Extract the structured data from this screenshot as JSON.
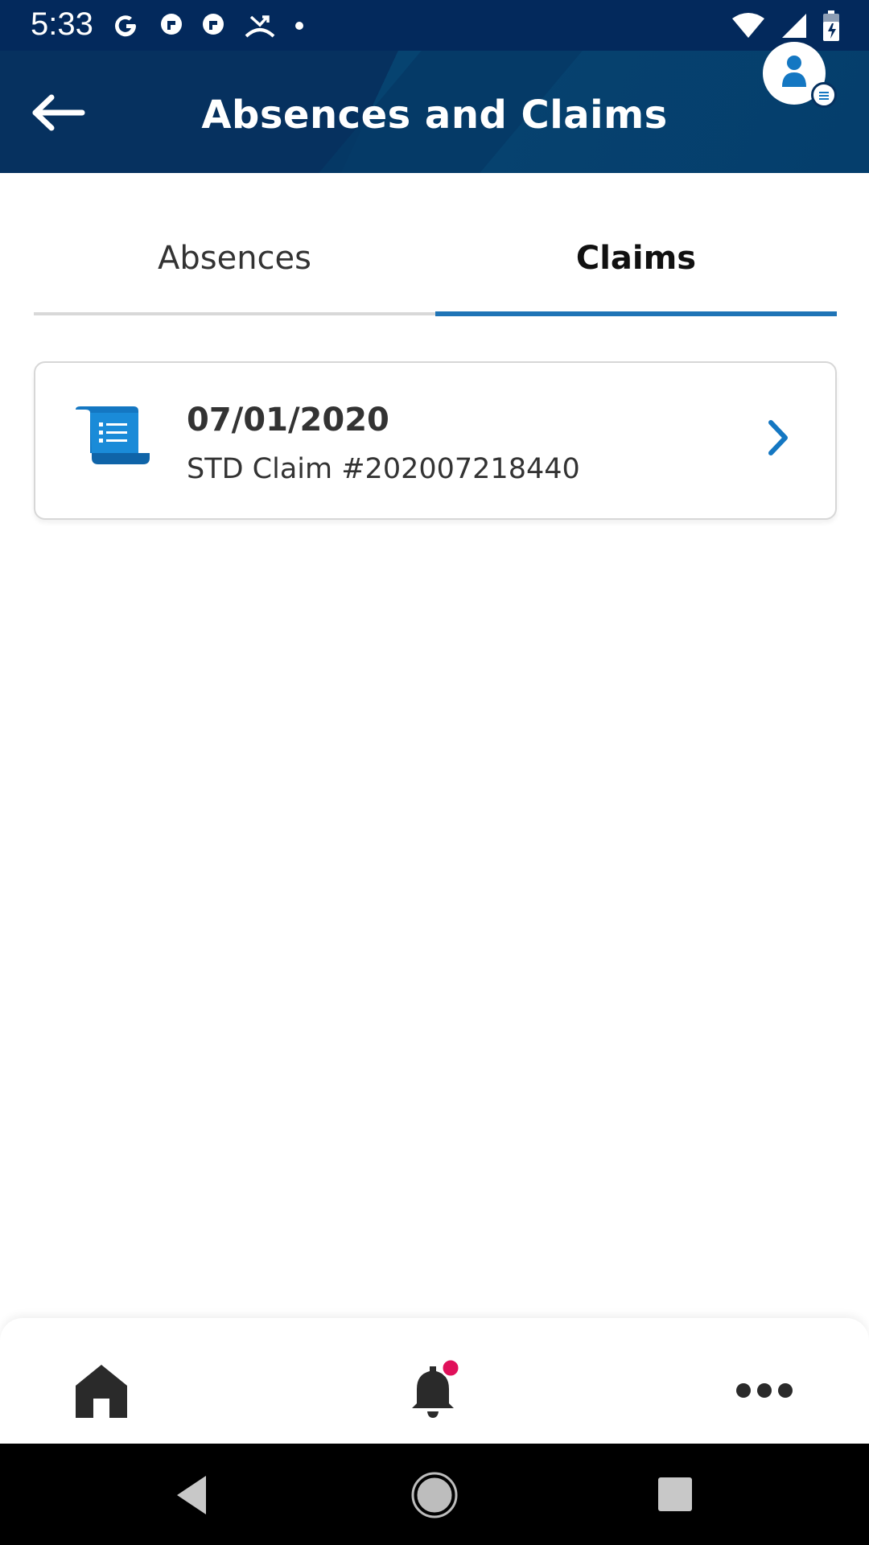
{
  "status_bar": {
    "time": "5:33",
    "left_icons": [
      "google-icon",
      "pocket-icon",
      "pocket-icon",
      "missed-call-icon",
      "dot-icon"
    ],
    "right_icons": [
      "wifi-icon",
      "signal-icon",
      "battery-icon"
    ]
  },
  "header": {
    "title": "Absences and Claims",
    "back_icon": "arrow-left-icon",
    "avatar_icon": "user-icon",
    "background_color": "#06315f"
  },
  "tabs": [
    {
      "label": "Absences",
      "active": false
    },
    {
      "label": "Claims",
      "active": true
    }
  ],
  "accent_color": "#1f74b6",
  "claims": [
    {
      "date": "07/01/2020",
      "title": "STD Claim #202007218440",
      "icon": "scroll-document-icon"
    }
  ],
  "bottom_nav": {
    "items": [
      {
        "name": "home",
        "icon": "home-icon"
      },
      {
        "name": "notifications",
        "icon": "bell-icon",
        "has_badge": true
      },
      {
        "name": "more",
        "icon": "more-dots-icon"
      }
    ],
    "badge_color": "#e0105a"
  },
  "system_nav": [
    "back-triangle-icon",
    "home-circle-icon",
    "recents-square-icon"
  ]
}
